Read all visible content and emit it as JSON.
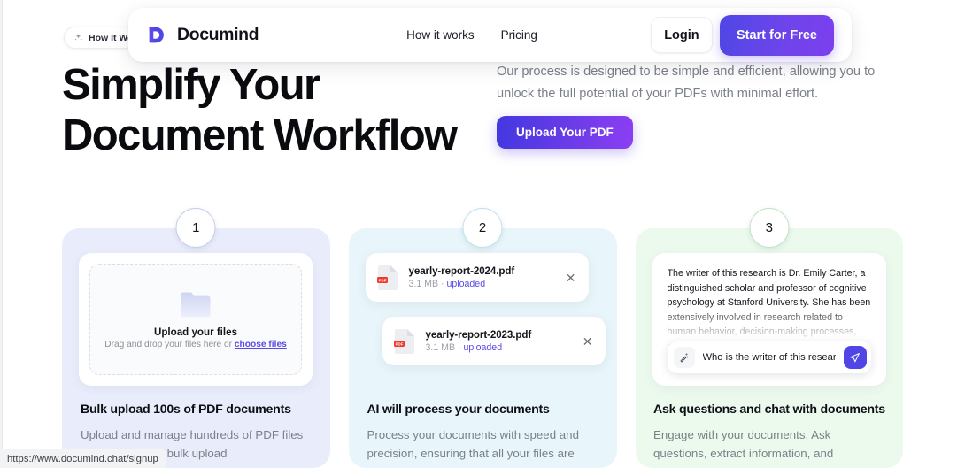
{
  "header": {
    "brand": "Documind",
    "logo_icon": "documind-d-logo",
    "nav": [
      {
        "label": "How it works"
      },
      {
        "label": "Pricing"
      }
    ],
    "login_label": "Login",
    "cta_label": "Start for Free"
  },
  "hero": {
    "badge": {
      "icon": "sparkle-icon",
      "label": "How It Wo"
    },
    "title_line1": "Simplify Your",
    "title_line2": "Document Workflow",
    "subtitle": "Our process is designed to be simple and efficient, allowing you to unlock the full potential of your PDFs with minimal effort.",
    "upload_button": "Upload Your PDF"
  },
  "steps": [
    {
      "number": "1",
      "accent": "#e9edfb",
      "title": "Bulk upload 100s of PDF documents",
      "description": "Upload and manage hundreds of PDF files at once with our bulk upload",
      "dropzone": {
        "icon": "folder-icon",
        "title": "Upload your files",
        "hint_prefix": "Drag and drop your files here or ",
        "hint_link": "choose files"
      }
    },
    {
      "number": "2",
      "accent": "#e8f6fb",
      "title": "AI will process your documents",
      "description": "Process your documents with speed and precision, ensuring that all your files are",
      "files": [
        {
          "icon": "pdf-file-icon",
          "name": "yearly-report-2024.pdf",
          "size": "3.1 MB",
          "separator": "·",
          "status": "uploaded",
          "close_icon": "close-icon"
        },
        {
          "icon": "pdf-file-icon",
          "name": "yearly-report-2023.pdf",
          "size": "3.1 MB",
          "separator": "·",
          "status": "uploaded",
          "close_icon": "close-icon"
        }
      ]
    },
    {
      "number": "3",
      "accent": "#ecfaee",
      "title": "Ask questions and chat with documents",
      "description": "Engage with your documents. Ask questions, extract information, and",
      "chat": {
        "answer": "The writer of this research is Dr. Emily Carter, a distinguished scholar and professor of cognitive psychology at Stanford University. She has been extensively involved in research related to human behavior, decision-making processes, and mental health.",
        "wand_icon": "magic-wand-icon",
        "question": "Who is the writer of this research?",
        "send_icon": "send-paper-plane-icon"
      }
    }
  ],
  "status_bar": {
    "url": "https://www.documind.chat/signup"
  },
  "colors": {
    "brand_purple": "#4f46e5",
    "gradient_end": "#8b3ef2",
    "link_purple": "#5b4ae8",
    "pdf_red": "#ef3a2d",
    "muted_text": "#7b8089"
  }
}
